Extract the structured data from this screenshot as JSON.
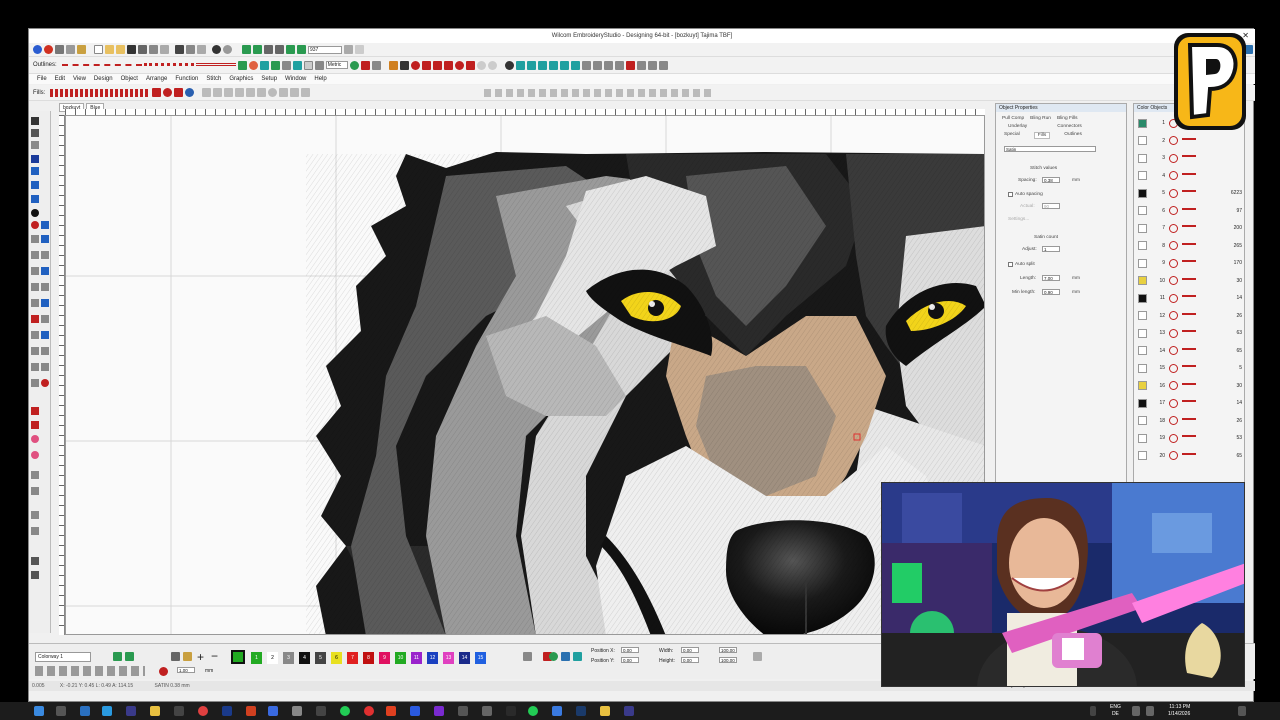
{
  "window": {
    "title": "Wilcom EmbroideryStudio - Designing 64-bit - [bozkuyt]    Tajima TBF]",
    "close_glyph": "✕"
  },
  "toolbar_outlines_label": "Outlines:",
  "toolbar_fills_label": "Fills:",
  "toolbar_metric": "Metric",
  "toolbar_zoom": "937",
  "menu": [
    "File",
    "Edit",
    "View",
    "Design",
    "Object",
    "Arrange",
    "Function",
    "Stitch",
    "Graphics",
    "Setup",
    "Window",
    "Help"
  ],
  "doc_tabs": [
    "bozkuyt",
    "Blue"
  ],
  "object_properties": {
    "title": "Object Properties",
    "tabs_row1": [
      "Pull Comp",
      "Bling Run",
      "Bling Fills"
    ],
    "tabs_row2": [
      "Underlay",
      "Connectors"
    ],
    "tabs_row3": [
      "Special",
      "Fills",
      "Outlines"
    ],
    "fill_type": "Satin",
    "stitch_values": "Stitch values",
    "spacing_label": "Spacing:",
    "spacing_value": "0.38",
    "auto_spacing": "Auto spacing",
    "actual_label": "Actual:",
    "actual_value": "90",
    "settings": "Settings...",
    "satin_count": "Satin count",
    "adjust_label": "Adjust:",
    "adjust_value": "1",
    "auto_split": "Auto split",
    "length_label": "Length:",
    "length_value": "7.00",
    "minlength_label": "Min length:",
    "minlength_value": "0.90",
    "unit_mm": "mm"
  },
  "color_objects": {
    "title": "Color Objects",
    "rows": [
      {
        "n": "1",
        "count": "",
        "color": "#2a8a6a"
      },
      {
        "n": "2",
        "count": "",
        "color": "#ffffff"
      },
      {
        "n": "3",
        "count": "",
        "color": "#ffffff"
      },
      {
        "n": "4",
        "count": "",
        "color": "#ffffff"
      },
      {
        "n": "5",
        "count": "6223",
        "color": "#111111"
      },
      {
        "n": "6",
        "count": "97",
        "color": "#ffffff"
      },
      {
        "n": "7",
        "count": "200",
        "color": "#ffffff"
      },
      {
        "n": "8",
        "count": "265",
        "color": "#ffffff"
      },
      {
        "n": "9",
        "count": "170",
        "color": "#ffffff"
      },
      {
        "n": "10",
        "count": "30",
        "color": "#e8d040"
      },
      {
        "n": "11",
        "count": "14",
        "color": "#111111"
      },
      {
        "n": "12",
        "count": "26",
        "color": "#ffffff"
      },
      {
        "n": "13",
        "count": "63",
        "color": "#ffffff"
      },
      {
        "n": "14",
        "count": "65",
        "color": "#ffffff"
      },
      {
        "n": "15",
        "count": "5",
        "color": "#ffffff"
      },
      {
        "n": "16",
        "count": "30",
        "color": "#e8d040"
      },
      {
        "n": "17",
        "count": "14",
        "color": "#111111"
      },
      {
        "n": "18",
        "count": "26",
        "color": "#ffffff"
      },
      {
        "n": "19",
        "count": "53",
        "color": "#ffffff"
      },
      {
        "n": "20",
        "count": "65",
        "color": "#ffffff"
      }
    ]
  },
  "palette": {
    "colorway": "Colorway 1",
    "swatches": [
      {
        "n": "1",
        "color": "#22aa22"
      },
      {
        "n": "2",
        "color": "#ffffff"
      },
      {
        "n": "3",
        "color": "#888888"
      },
      {
        "n": "4",
        "color": "#111111"
      },
      {
        "n": "5",
        "color": "#444444"
      },
      {
        "n": "6",
        "color": "#e8e020"
      },
      {
        "n": "7",
        "color": "#e02020"
      },
      {
        "n": "8",
        "color": "#c01010"
      },
      {
        "n": "9",
        "color": "#e01060"
      },
      {
        "n": "10",
        "color": "#22aa22"
      },
      {
        "n": "11",
        "color": "#9a22cc"
      },
      {
        "n": "12",
        "color": "#1a40c0"
      },
      {
        "n": "13",
        "color": "#e040c0"
      },
      {
        "n": "14",
        "color": "#1a2a8a"
      },
      {
        "n": "15",
        "color": "#2060e0"
      }
    ],
    "zoom_value": "1.00",
    "zoom_unit": "mm",
    "position_x": "Position X:",
    "position_y": "Position Y:",
    "pos_x_val": "0.00",
    "pos_y_val": "0.00",
    "width_label": "Width:",
    "height_label": "Height:",
    "w_val": "0.00",
    "h_val": "0.00",
    "pct_w": "100.00",
    "pct_h": "100.00"
  },
  "status": {
    "left": "0.005",
    "coords": "X: -0.21 Y: 0.45 L: 0.49 A: 114.15",
    "satin": "SATIN  0.38 mm",
    "center": "[used]"
  },
  "taskbar": {
    "lang": "ENG",
    "region": "DE",
    "time": "11:13 PM",
    "date": "1/14/2026"
  },
  "logo_letter": "P"
}
